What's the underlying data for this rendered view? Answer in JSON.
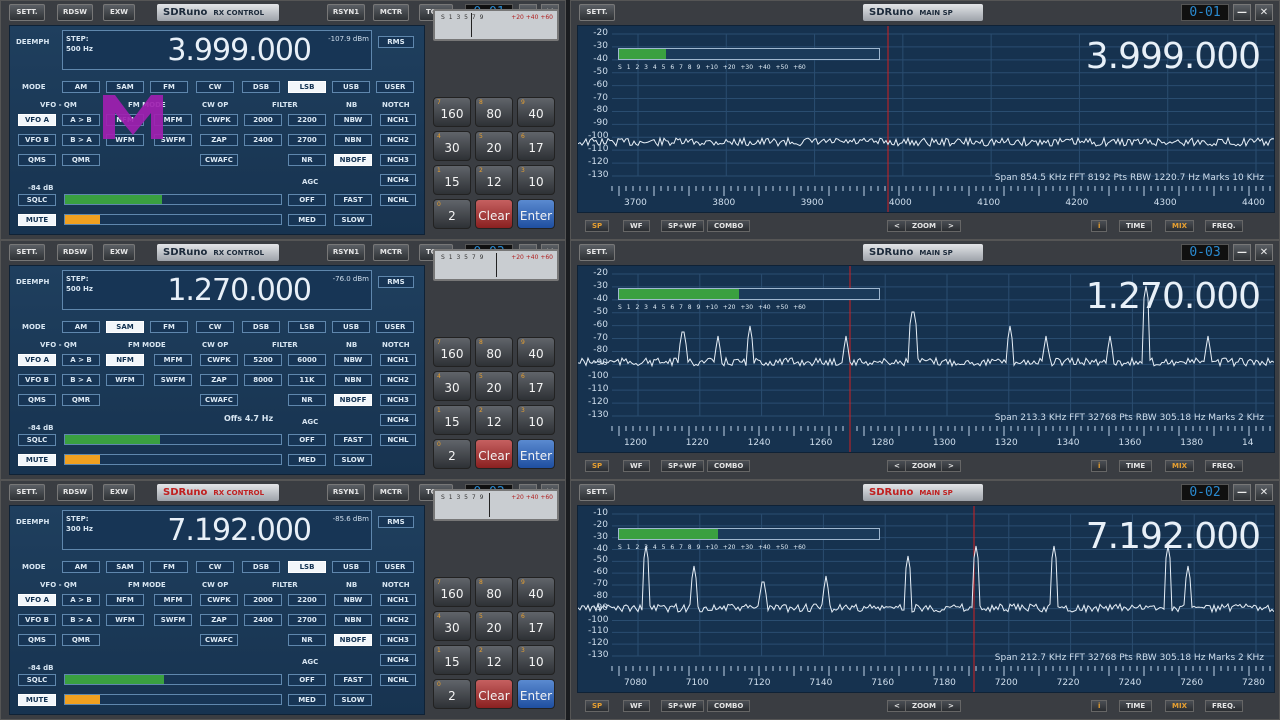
{
  "common": {
    "sett": "SETT.",
    "rdsw": "RDSW",
    "exw": "EXW",
    "rsyn": "RSYN1",
    "mctr": "MCTR",
    "tctr": "TCTR",
    "min": "—",
    "close": "✕",
    "brand": "SDRuno",
    "rx_title": "RX CONTROL",
    "sp_title": "MAIN SP",
    "deemph": "DEEMPH",
    "step_label": "STEP:",
    "rms": "RMS",
    "mode_label": "MODE",
    "vfo_qm": "VFO - QM",
    "fm_mode": "FM MODE",
    "cw_op": "CW OP",
    "filter_label": "FILTER",
    "nb_label": "NB",
    "notch_label": "NOTCH",
    "agc_label": "AGC",
    "modes": [
      "AM",
      "SAM",
      "FM",
      "CW",
      "DSB",
      "LSB",
      "USB",
      "USER"
    ],
    "vfoa": "VFO A",
    "vfob": "VFO B",
    "atob": "A > B",
    "btoa": "B > A",
    "qms": "QMS",
    "qmr": "QMR",
    "nfm": "NFM",
    "mfm": "MFM",
    "wfm": "WFM",
    "swfm": "SWFM",
    "cwpk": "CWPK",
    "zap": "ZAP",
    "cwafc": "CWAFC",
    "nbw": "NBW",
    "nbn": "NBN",
    "nr": "NR",
    "nboff": "NBOFF",
    "nch": [
      "NCH1",
      "NCH2",
      "NCH3",
      "NCH4",
      "NCHL"
    ],
    "sqlc": "SQLC",
    "mute": "MUTE",
    "agc": [
      "OFF",
      "FAST",
      "MED",
      "SLOW"
    ],
    "keypad": [
      {
        "s": "7",
        "v": "160"
      },
      {
        "s": "8",
        "v": "80"
      },
      {
        "s": "9",
        "v": "40"
      },
      {
        "s": "4",
        "v": "30"
      },
      {
        "s": "5",
        "v": "20"
      },
      {
        "s": "6",
        "v": "17"
      },
      {
        "s": "1",
        "v": "15"
      },
      {
        "s": "2",
        "v": "12"
      },
      {
        "s": "3",
        "v": "10"
      },
      {
        "s": "0",
        "v": "2"
      }
    ],
    "clear": "Clear",
    "enter": "Enter",
    "smeter_black": "S 1 3 5 7 9",
    "smeter_red": "+20 +40 +60",
    "sm_scale": "S 1 2 3 4 5 6 7 8 9 +10 +20 +30 +40 +50 +60",
    "spbtn": [
      "SP",
      "WF",
      "SP+WF",
      "COMBO"
    ],
    "zoom": "ZOOM",
    "zl": "<",
    "zr": ">",
    "i": "i",
    "time": "TIME",
    "mix": "MIX",
    "freq": "FREQ."
  },
  "rows": [
    {
      "clock": "0-01",
      "freq": "3.999.000",
      "dbm": "-107.9 dBm",
      "step": "500 Hz",
      "dbfs": "-84 dB",
      "mode_sel": 5,
      "filters": [
        "2000",
        "2200",
        "2400",
        "2700"
      ],
      "offs": "",
      "sp_freq": "3.999.000",
      "info": "Span 854.5 KHz   FFT 8192 Pts   RBW 1220.7 Hz   Marks 10 KHz",
      "yticks": [
        "-20",
        "-30",
        "-40",
        "-50",
        "-60",
        "-70",
        "-80",
        "-90",
        "-100",
        "-110",
        "-120",
        "-130"
      ],
      "xticks": [
        "3700",
        "3800",
        "3900",
        "4000",
        "4100",
        "4200",
        "4300",
        "4400"
      ],
      "sm_level": 0.18,
      "sql_level": 0.45,
      "brand_red": false
    },
    {
      "clock": "0-03",
      "freq": "1.270.000",
      "dbm": "-76.0 dBm",
      "step": "500 Hz",
      "dbfs": "-84 dB",
      "mode_sel": 1,
      "filters": [
        "5200",
        "6000",
        "8000",
        "11K"
      ],
      "offs": "Offs 4.7 Hz",
      "sp_freq": "1.270.000",
      "info": "Span 213.3 KHz   FFT 32768 Pts   RBW 305.18 Hz   Marks 2 KHz",
      "yticks": [
        "-20",
        "-30",
        "-40",
        "-50",
        "-60",
        "-70",
        "-80",
        "-90",
        "-100",
        "-110",
        "-120",
        "-130"
      ],
      "xticks": [
        "1200",
        "1220",
        "1240",
        "1260",
        "1280",
        "1300",
        "1320",
        "1340",
        "1360",
        "1380",
        "14"
      ],
      "sm_level": 0.46,
      "sql_level": 0.44,
      "brand_red": false
    },
    {
      "clock": "0-02",
      "freq": "7.192.000",
      "dbm": "-85.6 dBm",
      "step": "300 Hz",
      "dbfs": "-84 dB",
      "mode_sel": 5,
      "filters": [
        "2000",
        "2200",
        "2400",
        "2700"
      ],
      "offs": "",
      "sp_freq": "7.192.000",
      "info": "Span 212.7 KHz   FFT 32768 Pts   RBW 305.18 Hz   Marks 2 KHz",
      "yticks": [
        "-10",
        "-20",
        "-30",
        "-40",
        "-50",
        "-60",
        "-70",
        "-80",
        "-90",
        "-100",
        "-110",
        "-120",
        "-130"
      ],
      "xticks": [
        "7080",
        "7100",
        "7120",
        "7140",
        "7160",
        "7180",
        "7200",
        "7220",
        "7240",
        "7260",
        "7280"
      ],
      "sm_level": 0.38,
      "sql_level": 0.46,
      "brand_red": true
    }
  ],
  "colors": {
    "panel": "#1f3f5e",
    "accent": "#3aa040",
    "orange": "#f0a020",
    "marker": "#d02020"
  }
}
